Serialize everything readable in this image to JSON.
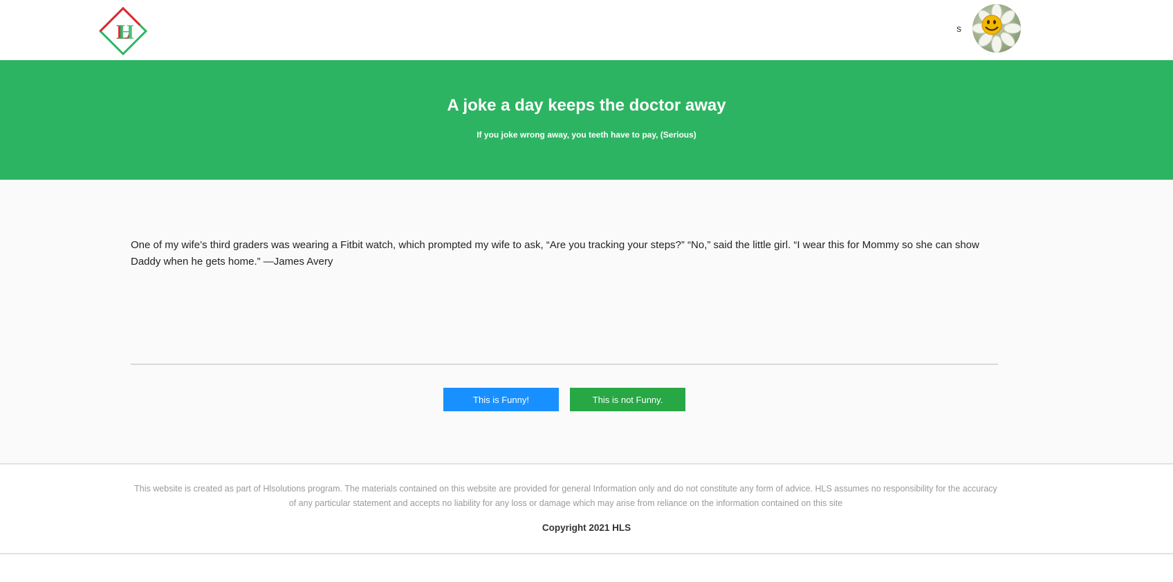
{
  "header": {
    "logo_icon": "hls-diamond-logo-icon",
    "user_name": "s",
    "avatar_icon": "smiley-flower-avatar-icon"
  },
  "hero": {
    "title": "A joke a day keeps the doctor away",
    "subtitle": "If you joke wrong away, you teeth have to pay, (Serious)",
    "background_color": "#2db462"
  },
  "joke": {
    "text": "One of my wife’s third graders was wearing a Fitbit watch, which prompted my wife to ask, “Are you tracking your steps?” “No,” said the little girl. “I wear this for Mommy so she can show Daddy when he gets home.” —James Avery"
  },
  "actions": {
    "funny_label": "This is Funny!",
    "not_funny_label": "This is not Funny.",
    "funny_color": "#1890ff",
    "not_funny_color": "#28a745"
  },
  "footer": {
    "disclaimer": "This website is created as part of Hlsolutions program. The materials contained on this website are provided for general Information only and do not constitute any form of advice. HLS assumes no responsibility for the accuracy of any particular statement and accepts no liability for any loss or damage which may arise from reliance on the information contained on this site",
    "copyright": "Copyright 2021 HLS"
  }
}
